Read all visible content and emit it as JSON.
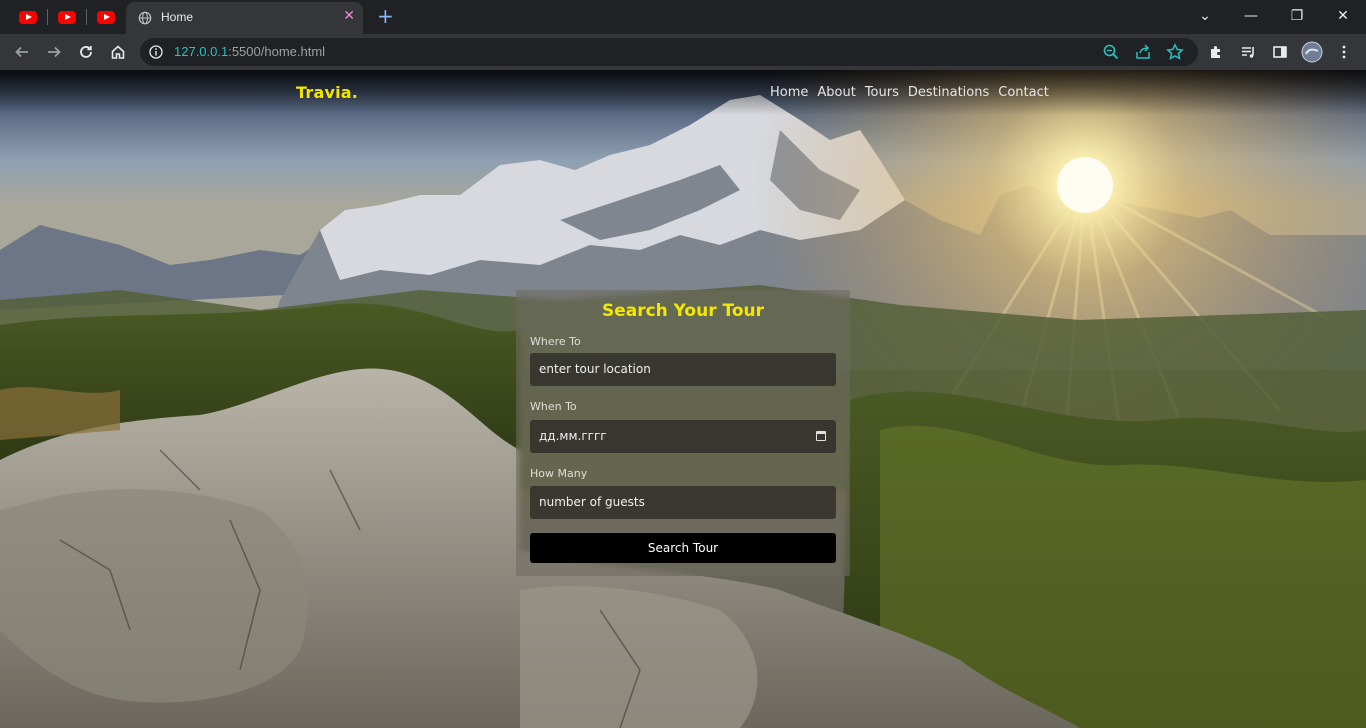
{
  "browser": {
    "pinned_tabs": [
      "youtube-icon",
      "youtube-icon",
      "youtube-icon"
    ],
    "active_tab": {
      "title": "Home"
    },
    "new_tab_symbol": "+",
    "window_controls": {
      "minimize": "—",
      "maximize": "❐",
      "close": "✕",
      "menu": "⌄"
    },
    "url": {
      "scheme": "",
      "host": "127.0.0.1",
      "rest": ":5500/home.html"
    },
    "accent": "#22c3c0"
  },
  "site": {
    "brand": "Travia.",
    "nav": [
      "Home",
      "About",
      "Tours",
      "Destinations",
      "Contact"
    ]
  },
  "search": {
    "title": "Search Your Tour",
    "where_label": "Where To",
    "where_placeholder": "enter tour location",
    "when_label": "When To",
    "when_value": "дд.мм.гггг",
    "how_label": "How Many",
    "how_placeholder": "number of guests",
    "button": "Search Tour"
  },
  "colors": {
    "brand": "#f2e600",
    "title": "#f5e800",
    "button": "#000000"
  }
}
